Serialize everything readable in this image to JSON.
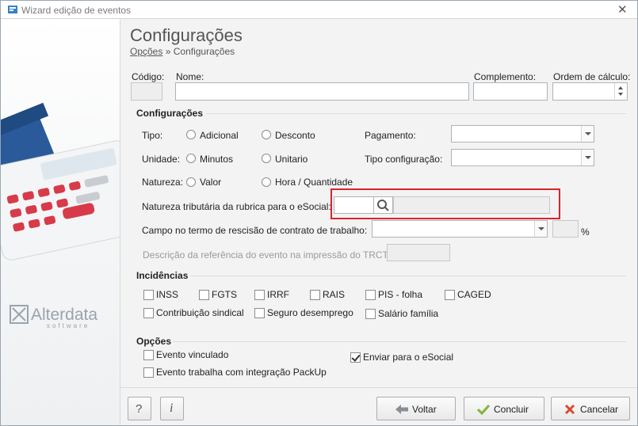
{
  "window": {
    "title": "Wizard edição de eventos"
  },
  "header": {
    "title": "Configurações",
    "breadcrumb_link": "Opções",
    "breadcrumb_sep": "»",
    "breadcrumb_current": "Configurações"
  },
  "top_fields": {
    "codigo_label": "Código:",
    "nome_label": "Nome:",
    "complemento_label": "Complemento:",
    "ordem_label": "Ordem de cálculo:"
  },
  "config": {
    "section": "Configurações",
    "tipo_label": "Tipo:",
    "tipo_opt1": "Adicional",
    "tipo_opt2": "Desconto",
    "unidade_label": "Unidade:",
    "unidade_opt1": "Minutos",
    "unidade_opt2": "Unitario",
    "natureza_label": "Natureza:",
    "natureza_opt1": "Valor",
    "natureza_opt2": "Hora / Quantidade",
    "pagamento_label": "Pagamento:",
    "tipo_config_label": "Tipo configuração:",
    "nat_trib_label": "Natureza tributária da rubrica para o eSocial:",
    "campo_trct_label": "Campo no termo de rescisão de contrato de trabalho:",
    "percent": "%",
    "descricao_label": "Descrição da referência do evento na impressão do TRCT:"
  },
  "incidencias": {
    "section": "Incidências",
    "items": [
      {
        "label": "INSS",
        "checked": false
      },
      {
        "label": "FGTS",
        "checked": false
      },
      {
        "label": "IRRF",
        "checked": false
      },
      {
        "label": "RAIS",
        "checked": false
      },
      {
        "label": "PIS - folha",
        "checked": false
      },
      {
        "label": "CAGED",
        "checked": false
      },
      {
        "label": "Contribuição sindical",
        "checked": false
      },
      {
        "label": "Seguro desemprego",
        "checked": false
      },
      {
        "label": "Salário família",
        "checked": false
      }
    ]
  },
  "opcoes": {
    "section": "Opções",
    "items": [
      {
        "label": "Evento vinculado",
        "checked": false
      },
      {
        "label": "Evento trabalha com integração PackUp",
        "checked": false
      },
      {
        "label": "Enviar para o eSocial",
        "checked": true
      }
    ]
  },
  "footer": {
    "help": "?",
    "info": "i",
    "voltar": "Voltar",
    "concluir": "Concluir",
    "cancelar": "Cancelar"
  },
  "brand": {
    "name": "Alterdata",
    "sub": "software"
  },
  "colors": {
    "highlight": "#d9232d",
    "brand_gray": "#9aa3ad"
  }
}
